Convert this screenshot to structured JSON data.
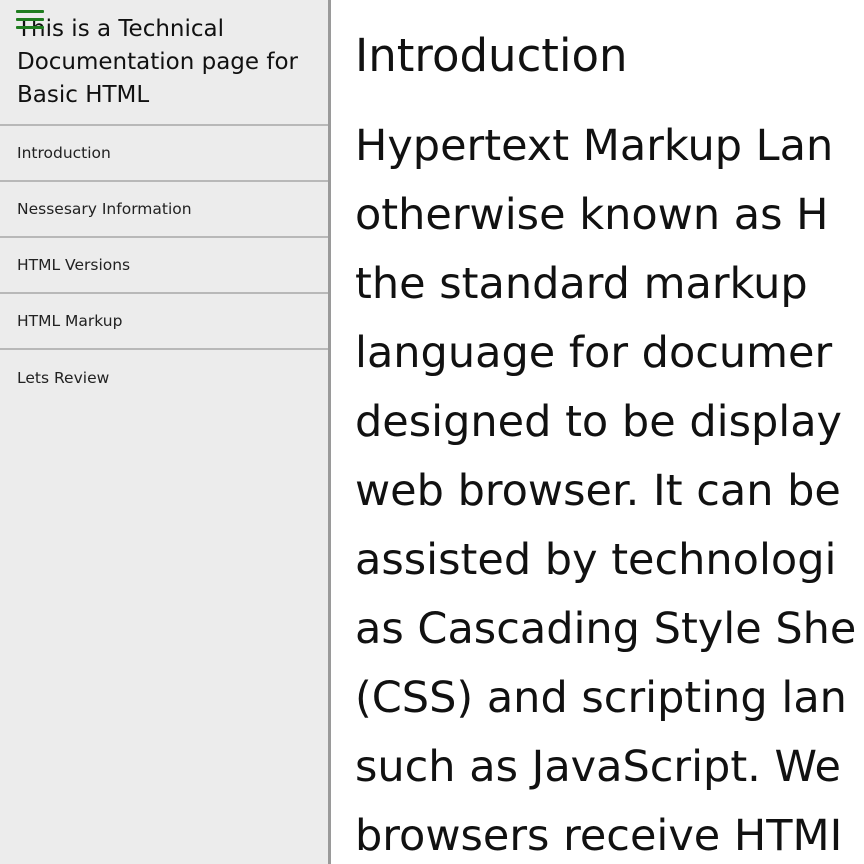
{
  "sidebar": {
    "menu_icon": "hamburger-menu-icon",
    "title": "This is a Technical Documentation page for Basic HTML",
    "items": [
      {
        "label": "Introduction"
      },
      {
        "label": "Nessesary Information"
      },
      {
        "label": "HTML Versions"
      },
      {
        "label": "HTML Markup"
      },
      {
        "label": "Lets Review"
      }
    ]
  },
  "main": {
    "section_title": "Introduction",
    "lines": [
      "Hypertext Markup Lan",
      "otherwise known as H",
      "the standard markup",
      "language for documer",
      "designed to be display",
      "web browser. It can be",
      "assisted by technologi",
      "as Cascading Style She",
      "(CSS) and scripting lan",
      "such as JavaScript. We",
      "browsers receive HTMI"
    ]
  },
  "colors": {
    "sidebar_bg": "#ececec",
    "divider": "#b8b8b8",
    "menu_icon": "#1f7d1f",
    "text": "#111111"
  }
}
